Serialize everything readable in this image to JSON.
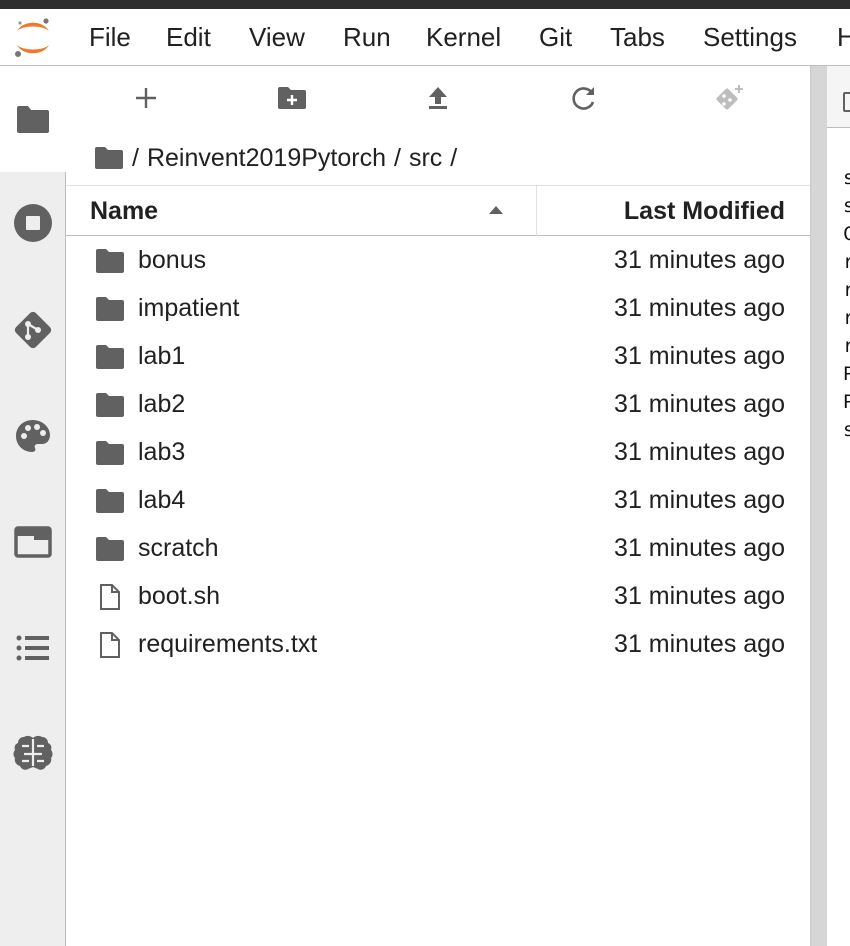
{
  "menu": {
    "items": [
      "File",
      "Edit",
      "View",
      "Run",
      "Kernel",
      "Git",
      "Tabs",
      "Settings",
      "H"
    ]
  },
  "left_sidebar": {
    "icons": [
      "folder-icon",
      "running-kernels-icon",
      "git-icon",
      "palette-icon",
      "tabs-icon",
      "table-of-contents-icon",
      "extension-brain-icon"
    ]
  },
  "file_browser": {
    "toolbar": [
      "new-launcher-icon",
      "new-folder-icon",
      "upload-icon",
      "refresh-icon",
      "git-clone-icon"
    ],
    "breadcrumb": {
      "root": "/",
      "segments": [
        "Reinvent2019Pytorch",
        "src"
      ],
      "separator": "/"
    },
    "columns": {
      "name": "Name",
      "modified": "Last Modified"
    },
    "sort": "name-ascending",
    "items": [
      {
        "name": "bonus",
        "type": "folder",
        "modified": "31 minutes ago"
      },
      {
        "name": "impatient",
        "type": "folder",
        "modified": "31 minutes ago"
      },
      {
        "name": "lab1",
        "type": "folder",
        "modified": "31 minutes ago"
      },
      {
        "name": "lab2",
        "type": "folder",
        "modified": "31 minutes ago"
      },
      {
        "name": "lab3",
        "type": "folder",
        "modified": "31 minutes ago"
      },
      {
        "name": "lab4",
        "type": "folder",
        "modified": "31 minutes ago"
      },
      {
        "name": "scratch",
        "type": "folder",
        "modified": "31 minutes ago"
      },
      {
        "name": "boot.sh",
        "type": "file",
        "modified": "31 minutes ago"
      },
      {
        "name": "requirements.txt",
        "type": "file",
        "modified": "31 minutes ago"
      }
    ]
  },
  "right_pane": {
    "visible_chars": [
      "s",
      "s",
      "C",
      "r",
      "r",
      "r",
      "r",
      "P",
      "P",
      "s"
    ]
  },
  "colors": {
    "accent_orange": "#F37726",
    "icon_gray": "#616161",
    "sidebar_bg": "#EEEEEE"
  }
}
